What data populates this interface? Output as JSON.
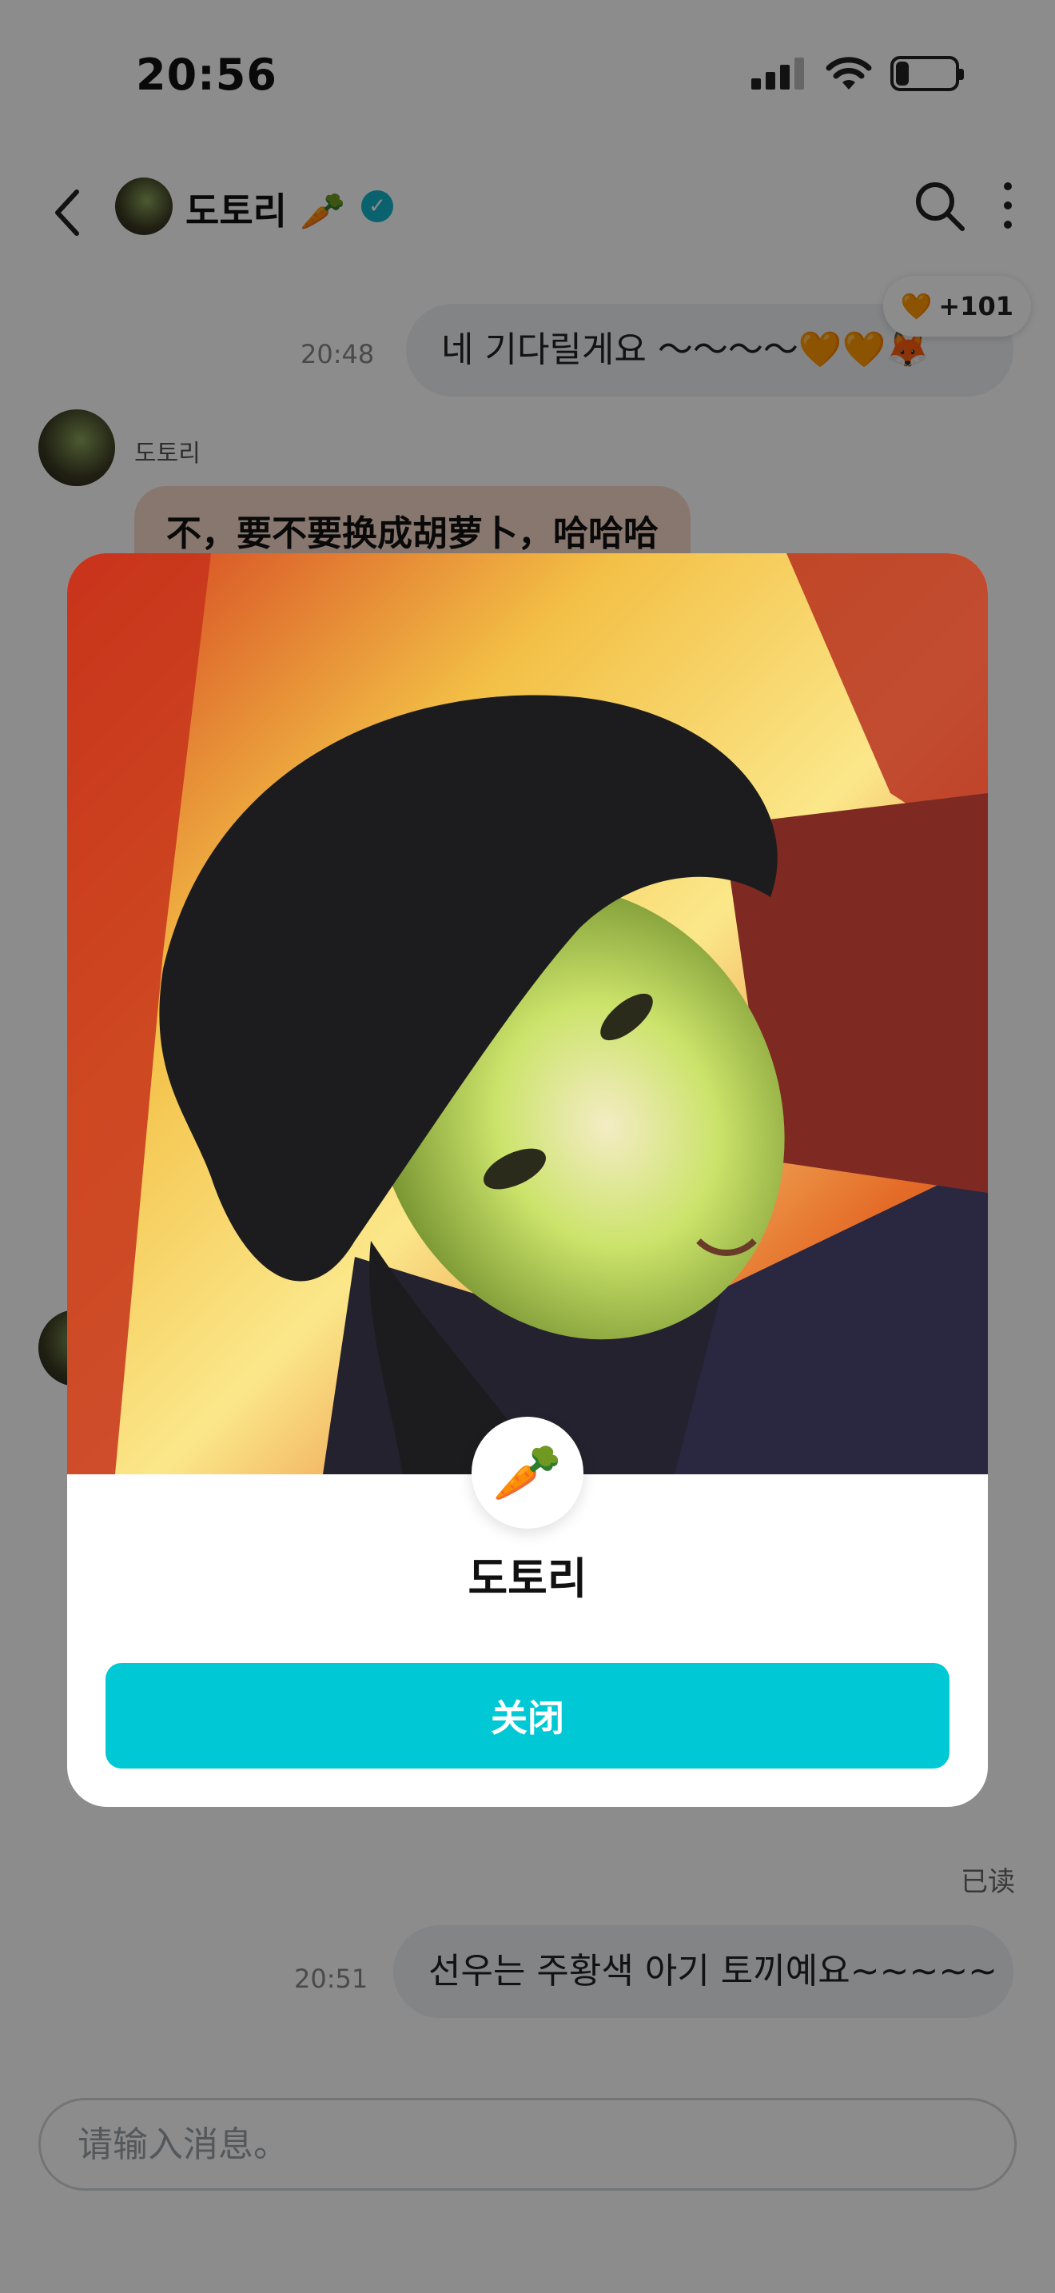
{
  "status_bar": {
    "time": "20:56",
    "battery": "21"
  },
  "header": {
    "name": "도토리 🥕",
    "verified_icon": "verified-badge-icon"
  },
  "messages": [
    {
      "time": "20:48",
      "text": "네 기다릴게요 ～～～～🧡🧡🦊",
      "reaction": "+101",
      "reaction_icon": "🧡"
    },
    {
      "sender": "도토리",
      "text": "不，要不要换成胡萝卜，哈哈哈"
    },
    {
      "time": "20:51",
      "text": "선우는 주황색 아기 토끼예요~~~~~"
    }
  ],
  "read_status": "已读",
  "input": {
    "placeholder": "请输入消息。"
  },
  "modal": {
    "badge_emoji": "🥕",
    "name": "도토리",
    "close_label": "关闭"
  },
  "colors": {
    "accent": "#00c8d4",
    "verified": "#12b3c8",
    "incoming_bubble": "#f8d9c8",
    "outgoing_bubble": "#eef0f3"
  }
}
